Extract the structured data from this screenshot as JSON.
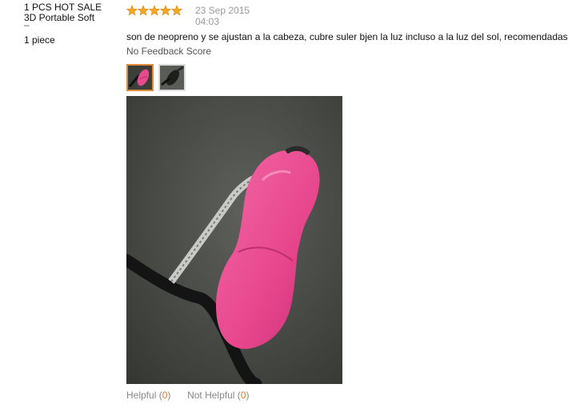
{
  "product": {
    "title_line1": "1 PCS HOT SALE",
    "title_line2": "3D Portable Soft",
    "title_dash": "–",
    "quantity": "1 piece"
  },
  "review": {
    "rating": 5,
    "rating_max": 5,
    "date": "23 Sep 2015",
    "time": "04:03",
    "text": "son de neopreno y se ajustan a la cabeza, cubre suler bjen la luz incluso a la luz del sol, recomendadas",
    "feedback_score": "No Feedback Score",
    "helpful_label": "Helpful",
    "helpful_count_open": "(",
    "helpful_count": "0",
    "helpful_count_close": ")",
    "not_helpful_label": "Not Helpful",
    "not_helpful_count_open": "(",
    "not_helpful_count": "0",
    "not_helpful_count_close": ")"
  },
  "thumbnails": [
    {
      "name": "pink-mask-thumbnail",
      "selected": true
    },
    {
      "name": "black-mask-thumbnail",
      "selected": false
    }
  ],
  "colors": {
    "star": "#f5a623",
    "accent": "#e07b2b",
    "muted": "#999999"
  }
}
